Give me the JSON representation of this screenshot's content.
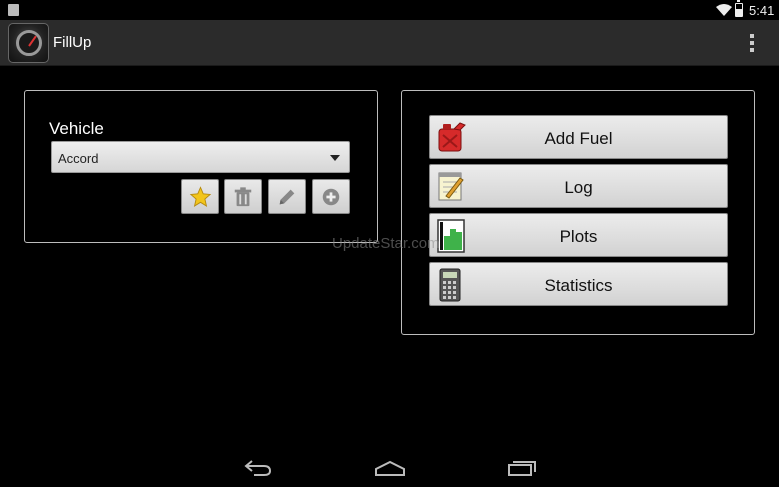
{
  "status_bar": {
    "time": "5:41"
  },
  "action_bar": {
    "title": "FillUp"
  },
  "vehicle": {
    "label": "Vehicle",
    "selected": "Accord"
  },
  "actions": [
    {
      "label": "Add Fuel",
      "icon": "fuel-can-icon"
    },
    {
      "label": "Log",
      "icon": "notepad-icon"
    },
    {
      "label": "Plots",
      "icon": "bar-chart-icon"
    },
    {
      "label": "Statistics",
      "icon": "calculator-icon"
    }
  ],
  "watermark": "UpdateStar.com"
}
